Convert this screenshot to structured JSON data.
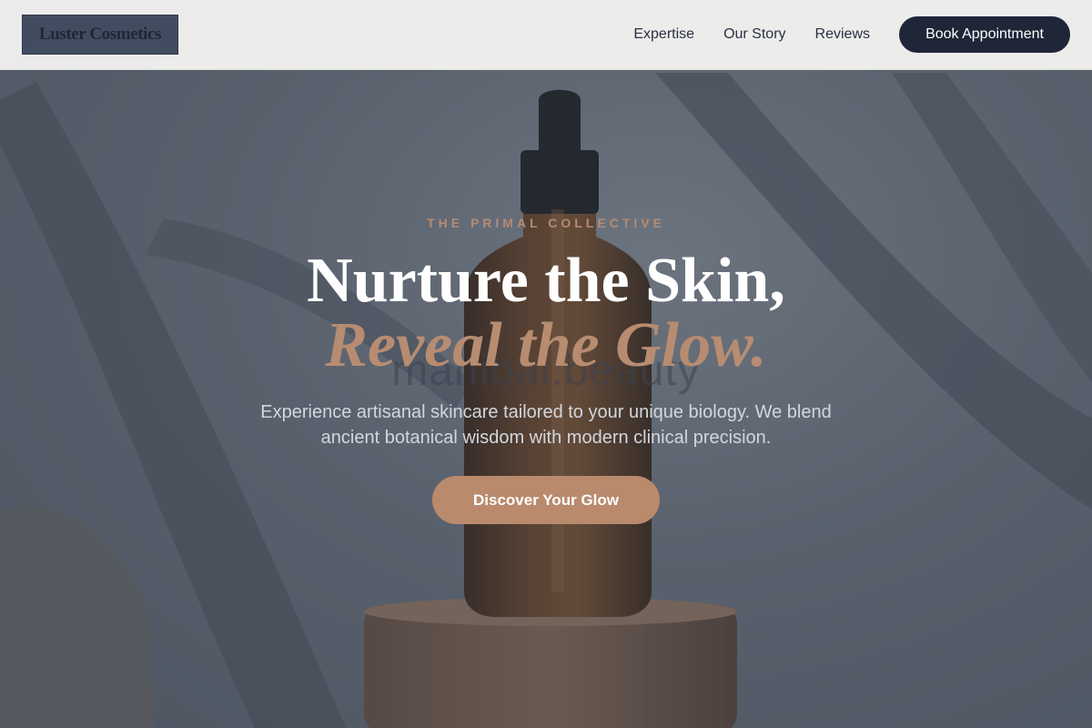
{
  "brand": {
    "logo_text": "Luster Cosmetics"
  },
  "nav": {
    "links": [
      "Expertise",
      "Our Story",
      "Reviews"
    ],
    "cta_label": "Book Appointment"
  },
  "hero": {
    "eyebrow": "THE PRIMAL COLLECTIVE",
    "title_line1": "Nurture the Skin,",
    "title_line2": "Reveal the Glow.",
    "background_text": "manibal.beauty",
    "subtitle": "Experience artisanal skincare tailored to your unique biology. We blend ancient botanical wisdom with modern clinical precision.",
    "cta_label": "Discover Your Glow",
    "image_icon": "serum-dropper-bottle"
  },
  "colors": {
    "accent": "#b98a6c",
    "navy": "#1e2638",
    "navbar_bg": "#f2f1f0"
  }
}
